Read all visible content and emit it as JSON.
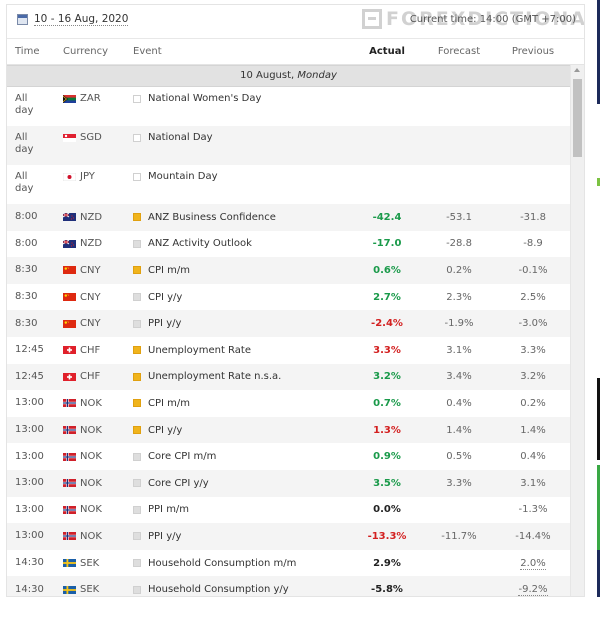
{
  "header": {
    "date_range": "10 - 16 Aug, 2020",
    "current_time": "Current time: 14:00 (GMT +7:00)",
    "watermark": "FOREXDICTIONARY"
  },
  "columns": {
    "time": "Time",
    "currency": "Currency",
    "event": "Event",
    "actual": "Actual",
    "forecast": "Forecast",
    "previous": "Previous"
  },
  "day": {
    "date": "10 August,",
    "weekday": "Monday"
  },
  "colors": {
    "positive": "#1a9a4a",
    "negative": "#d32020",
    "medium_impact": "#f0b41c"
  },
  "events": [
    {
      "time": "All day",
      "currency": "ZAR",
      "flag": "za-flag-icon",
      "impact": "none",
      "event": "National Women's Day",
      "actual": "",
      "forecast": "",
      "previous": "",
      "actual_color": ""
    },
    {
      "time": "All day",
      "currency": "SGD",
      "flag": "sg-flag-icon",
      "impact": "none",
      "event": "National Day",
      "actual": "",
      "forecast": "",
      "previous": "",
      "actual_color": ""
    },
    {
      "time": "All day",
      "currency": "JPY",
      "flag": "jp-flag-icon",
      "impact": "none",
      "event": "Mountain Day",
      "actual": "",
      "forecast": "",
      "previous": "",
      "actual_color": ""
    },
    {
      "time": "8:00",
      "currency": "NZD",
      "flag": "nz-flag-icon",
      "impact": "med",
      "event": "ANZ Business Confidence",
      "actual": "-42.4",
      "forecast": "-53.1",
      "previous": "-31.8",
      "actual_color": "green"
    },
    {
      "time": "8:00",
      "currency": "NZD",
      "flag": "nz-flag-icon",
      "impact": "low",
      "event": "ANZ Activity Outlook",
      "actual": "-17.0",
      "forecast": "-28.8",
      "previous": "-8.9",
      "actual_color": "green"
    },
    {
      "time": "8:30",
      "currency": "CNY",
      "flag": "cn-flag-icon",
      "impact": "med",
      "event": "CPI m/m",
      "actual": "0.6%",
      "forecast": "0.2%",
      "previous": "-0.1%",
      "actual_color": "green"
    },
    {
      "time": "8:30",
      "currency": "CNY",
      "flag": "cn-flag-icon",
      "impact": "low",
      "event": "CPI y/y",
      "actual": "2.7%",
      "forecast": "2.3%",
      "previous": "2.5%",
      "actual_color": "green"
    },
    {
      "time": "8:30",
      "currency": "CNY",
      "flag": "cn-flag-icon",
      "impact": "low",
      "event": "PPI y/y",
      "actual": "-2.4%",
      "forecast": "-1.9%",
      "previous": "-3.0%",
      "actual_color": "red"
    },
    {
      "time": "12:45",
      "currency": "CHF",
      "flag": "ch-flag-icon",
      "impact": "med",
      "event": "Unemployment Rate",
      "actual": "3.3%",
      "forecast": "3.1%",
      "previous": "3.3%",
      "actual_color": "red"
    },
    {
      "time": "12:45",
      "currency": "CHF",
      "flag": "ch-flag-icon",
      "impact": "med",
      "event": "Unemployment Rate n.s.a.",
      "actual": "3.2%",
      "forecast": "3.4%",
      "previous": "3.2%",
      "actual_color": "green"
    },
    {
      "time": "13:00",
      "currency": "NOK",
      "flag": "no-flag-icon",
      "impact": "med",
      "event": "CPI m/m",
      "actual": "0.7%",
      "forecast": "0.4%",
      "previous": "0.2%",
      "actual_color": "green"
    },
    {
      "time": "13:00",
      "currency": "NOK",
      "flag": "no-flag-icon",
      "impact": "med",
      "event": "CPI y/y",
      "actual": "1.3%",
      "forecast": "1.4%",
      "previous": "1.4%",
      "actual_color": "red"
    },
    {
      "time": "13:00",
      "currency": "NOK",
      "flag": "no-flag-icon",
      "impact": "low",
      "event": "Core CPI m/m",
      "actual": "0.9%",
      "forecast": "0.5%",
      "previous": "0.4%",
      "actual_color": "green"
    },
    {
      "time": "13:00",
      "currency": "NOK",
      "flag": "no-flag-icon",
      "impact": "low",
      "event": "Core CPI y/y",
      "actual": "3.5%",
      "forecast": "3.3%",
      "previous": "3.1%",
      "actual_color": "green"
    },
    {
      "time": "13:00",
      "currency": "NOK",
      "flag": "no-flag-icon",
      "impact": "low",
      "event": "PPI m/m",
      "actual": "0.0%",
      "forecast": "",
      "previous": "-1.3%",
      "actual_color": "black"
    },
    {
      "time": "13:00",
      "currency": "NOK",
      "flag": "no-flag-icon",
      "impact": "low",
      "event": "PPI y/y",
      "actual": "-13.3%",
      "forecast": "-11.7%",
      "previous": "-14.4%",
      "actual_color": "red"
    },
    {
      "time": "14:30",
      "currency": "SEK",
      "flag": "se-flag-icon",
      "impact": "low",
      "event": "Household Consumption m/m",
      "actual": "2.9%",
      "forecast": "",
      "previous": "2.0%",
      "actual_color": "black",
      "previous_revised": true
    },
    {
      "time": "14:30",
      "currency": "SEK",
      "flag": "se-flag-icon",
      "impact": "low",
      "event": "Household Consumption y/y",
      "actual": "-5.8%",
      "forecast": "",
      "previous": "-9.2%",
      "actual_color": "black",
      "previous_revised": true
    }
  ]
}
